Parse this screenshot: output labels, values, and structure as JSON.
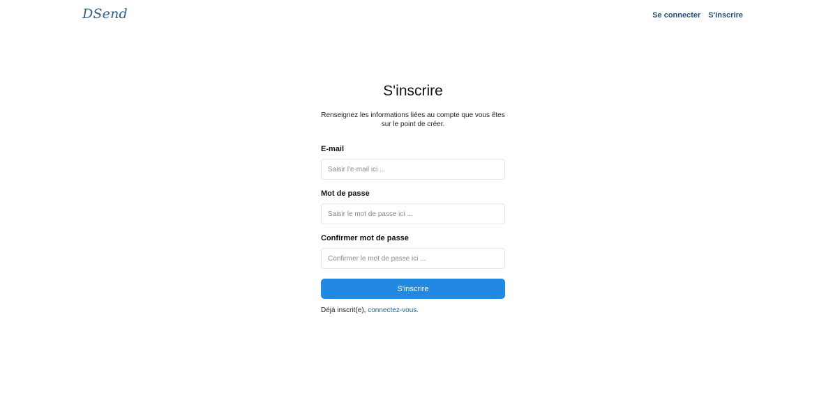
{
  "header": {
    "logo": "DSend",
    "nav": {
      "login_label": "Se connecter",
      "signup_label": "S'inscrire"
    }
  },
  "form": {
    "title": "S'inscrire",
    "subtitle": "Renseignez les informations liées au compte que vous êtes sur le point de créer.",
    "email": {
      "label": "E-mail",
      "placeholder": "Saisir l'e-mail ici ...",
      "value": ""
    },
    "password": {
      "label": "Mot de passe",
      "placeholder": "Saisir le mot de passe ici ...",
      "value": ""
    },
    "confirm_password": {
      "label": "Confirmer mot de passe",
      "placeholder": "Confirmer le mot de passe ici ...",
      "value": ""
    },
    "submit_label": "S'inscrire",
    "footer": {
      "prefix": "Déjà inscrit(e), ",
      "link_label": "connectez-vous."
    }
  },
  "colors": {
    "brand": "#2e5f8a",
    "nav_link": "#1f4e79",
    "primary_button": "#2289e2",
    "link": "#1f5f99"
  }
}
